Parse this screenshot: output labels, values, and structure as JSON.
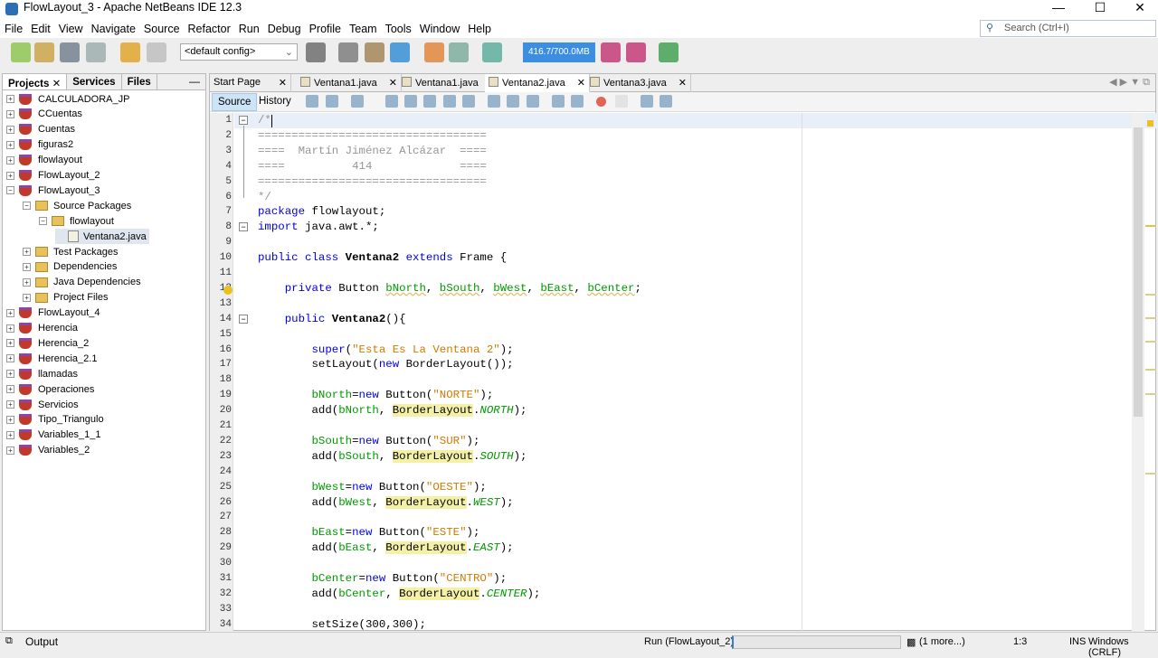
{
  "window": {
    "title": "FlowLayout_3 - Apache NetBeans IDE 12.3"
  },
  "menu": [
    "File",
    "Edit",
    "View",
    "Navigate",
    "Source",
    "Refactor",
    "Run",
    "Debug",
    "Profile",
    "Team",
    "Tools",
    "Window",
    "Help"
  ],
  "search": {
    "placeholder": "Search (Ctrl+I)"
  },
  "toolbar": {
    "config": "<default config>",
    "memory": "416.7/700.0MB",
    "memory_fraction": 0.595
  },
  "projects": {
    "tabs": [
      "Projects",
      "Services",
      "Files"
    ],
    "items": [
      {
        "label": "CALCULADORA_JP",
        "type": "project",
        "depth": 0,
        "exp": "+"
      },
      {
        "label": "CCuentas",
        "type": "project",
        "depth": 0,
        "exp": "+"
      },
      {
        "label": "Cuentas",
        "type": "project",
        "depth": 0,
        "exp": "+"
      },
      {
        "label": "figuras2",
        "type": "project",
        "depth": 0,
        "exp": "+"
      },
      {
        "label": "flowlayout",
        "type": "project",
        "depth": 0,
        "exp": "+"
      },
      {
        "label": "FlowLayout_2",
        "type": "project",
        "depth": 0,
        "exp": "+"
      },
      {
        "label": "FlowLayout_3",
        "type": "project",
        "depth": 0,
        "exp": "−"
      },
      {
        "label": "Source Packages",
        "type": "folder",
        "depth": 1,
        "exp": "−"
      },
      {
        "label": "flowlayout",
        "type": "folder",
        "depth": 2,
        "exp": "−"
      },
      {
        "label": "Ventana2.java",
        "type": "file",
        "depth": 3,
        "exp": ""
      },
      {
        "label": "Test Packages",
        "type": "folder",
        "depth": 1,
        "exp": "+"
      },
      {
        "label": "Dependencies",
        "type": "folder",
        "depth": 1,
        "exp": "+"
      },
      {
        "label": "Java Dependencies",
        "type": "folder",
        "depth": 1,
        "exp": "+"
      },
      {
        "label": "Project Files",
        "type": "folder",
        "depth": 1,
        "exp": "+"
      },
      {
        "label": "FlowLayout_4",
        "type": "project",
        "depth": 0,
        "exp": "+"
      },
      {
        "label": "Herencia",
        "type": "project",
        "depth": 0,
        "exp": "+"
      },
      {
        "label": "Herencia_2",
        "type": "project",
        "depth": 0,
        "exp": "+"
      },
      {
        "label": "Herencia_2.1",
        "type": "project",
        "depth": 0,
        "exp": "+"
      },
      {
        "label": "llamadas",
        "type": "project",
        "depth": 0,
        "exp": "+"
      },
      {
        "label": "Operaciones",
        "type": "project",
        "depth": 0,
        "exp": "+"
      },
      {
        "label": "Servicios",
        "type": "project",
        "depth": 0,
        "exp": "+"
      },
      {
        "label": "Tipo_Triangulo",
        "type": "project",
        "depth": 0,
        "exp": "+"
      },
      {
        "label": "Variables_1_1",
        "type": "project",
        "depth": 0,
        "exp": "+"
      },
      {
        "label": "Variables_2",
        "type": "project",
        "depth": 0,
        "exp": "+"
      }
    ]
  },
  "editor": {
    "tabs": [
      {
        "label": "Start Page",
        "active": false
      },
      {
        "label": "Ventana1.java",
        "active": false
      },
      {
        "label": "Ventana1.java",
        "active": false
      },
      {
        "label": "Ventana2.java",
        "active": true
      },
      {
        "label": "Ventana3.java",
        "active": false
      }
    ],
    "source_label": "Source",
    "history_label": "History",
    "lines": [
      [
        [
          "/*",
          "com"
        ]
      ],
      [
        [
          "==================================",
          "com"
        ]
      ],
      [
        [
          "====  Martín Jiménez Alcázar  ====",
          "com"
        ]
      ],
      [
        [
          "====          414             ====",
          "com"
        ]
      ],
      [
        [
          "==================================",
          "com"
        ]
      ],
      [
        [
          "*/",
          "com"
        ]
      ],
      [
        [
          "package",
          "kw"
        ],
        [
          " flowlayout;",
          ""
        ]
      ],
      [
        [
          "import",
          "kw"
        ],
        [
          " java.awt.*;",
          ""
        ]
      ],
      [],
      [
        [
          "public class ",
          "kw"
        ],
        [
          "Ventana2",
          "cls"
        ],
        [
          " extends ",
          "kw"
        ],
        [
          "Frame {",
          ""
        ]
      ],
      [],
      [
        [
          "    private ",
          "kw"
        ],
        [
          "Button ",
          ""
        ],
        [
          "bNorth",
          "fld warn"
        ],
        [
          ", ",
          ""
        ],
        [
          "bSouth",
          "fld warn"
        ],
        [
          ", ",
          ""
        ],
        [
          "bWest",
          "fld warn"
        ],
        [
          ", ",
          ""
        ],
        [
          "bEast",
          "fld warn"
        ],
        [
          ", ",
          ""
        ],
        [
          "bCenter",
          "fld warn"
        ],
        [
          ";",
          ""
        ]
      ],
      [],
      [
        [
          "    public ",
          "kw"
        ],
        [
          "Ventana2",
          "cls"
        ],
        [
          "(){",
          ""
        ]
      ],
      [],
      [
        [
          "        super",
          "kw"
        ],
        [
          "(",
          ""
        ],
        [
          "\"Esta Es La Ventana 2\"",
          "str"
        ],
        [
          ");",
          ""
        ]
      ],
      [
        [
          "        setLayout(",
          ""
        ],
        [
          "new ",
          "kw"
        ],
        [
          "BorderLayout());",
          ""
        ]
      ],
      [],
      [
        [
          "        bNorth",
          "fld"
        ],
        [
          "=",
          ""
        ],
        [
          "new ",
          "kw"
        ],
        [
          "Button(",
          ""
        ],
        [
          "\"NORTE\"",
          "str"
        ],
        [
          ");",
          ""
        ]
      ],
      [
        [
          "        add(",
          ""
        ],
        [
          "bNorth",
          "fld"
        ],
        [
          ", ",
          ""
        ],
        [
          "BorderLayout",
          "hl"
        ],
        [
          ".",
          ""
        ],
        [
          "NORTH",
          "const"
        ],
        [
          ");",
          ""
        ]
      ],
      [],
      [
        [
          "        bSouth",
          "fld"
        ],
        [
          "=",
          ""
        ],
        [
          "new ",
          "kw"
        ],
        [
          "Button(",
          ""
        ],
        [
          "\"SUR\"",
          "str"
        ],
        [
          ");",
          ""
        ]
      ],
      [
        [
          "        add(",
          ""
        ],
        [
          "bSouth",
          "fld"
        ],
        [
          ", ",
          ""
        ],
        [
          "BorderLayout",
          "hl"
        ],
        [
          ".",
          ""
        ],
        [
          "SOUTH",
          "const"
        ],
        [
          ");",
          ""
        ]
      ],
      [],
      [
        [
          "        bWest",
          "fld"
        ],
        [
          "=",
          ""
        ],
        [
          "new ",
          "kw"
        ],
        [
          "Button(",
          ""
        ],
        [
          "\"OESTE\"",
          "str"
        ],
        [
          ");",
          ""
        ]
      ],
      [
        [
          "        add(",
          ""
        ],
        [
          "bWest",
          "fld"
        ],
        [
          ", ",
          ""
        ],
        [
          "BorderLayout",
          "hl"
        ],
        [
          ".",
          ""
        ],
        [
          "WEST",
          "const"
        ],
        [
          ");",
          ""
        ]
      ],
      [],
      [
        [
          "        bEast",
          "fld"
        ],
        [
          "=",
          ""
        ],
        [
          "new ",
          "kw"
        ],
        [
          "Button(",
          ""
        ],
        [
          "\"ESTE\"",
          "str"
        ],
        [
          ");",
          ""
        ]
      ],
      [
        [
          "        add(",
          ""
        ],
        [
          "bEast",
          "fld"
        ],
        [
          ", ",
          ""
        ],
        [
          "BorderLayout",
          "hl"
        ],
        [
          ".",
          ""
        ],
        [
          "EAST",
          "const"
        ],
        [
          ");",
          ""
        ]
      ],
      [],
      [
        [
          "        bCenter",
          "fld"
        ],
        [
          "=",
          ""
        ],
        [
          "new ",
          "kw"
        ],
        [
          "Button(",
          ""
        ],
        [
          "\"CENTRO\"",
          "str"
        ],
        [
          ");",
          ""
        ]
      ],
      [
        [
          "        add(",
          ""
        ],
        [
          "bCenter",
          "fld"
        ],
        [
          ", ",
          ""
        ],
        [
          "BorderLayout",
          "hl"
        ],
        [
          ".",
          ""
        ],
        [
          "CENTER",
          "const"
        ],
        [
          ");",
          ""
        ]
      ],
      [],
      [
        [
          "        setSize(300,300);",
          ""
        ]
      ]
    ]
  },
  "status": {
    "output_label": "Output",
    "run_task": "Run (FlowLayout_2)",
    "more": "(1 more...)",
    "position": "1:3",
    "mode": "INS",
    "line_ending": "Windows (CRLF)"
  }
}
